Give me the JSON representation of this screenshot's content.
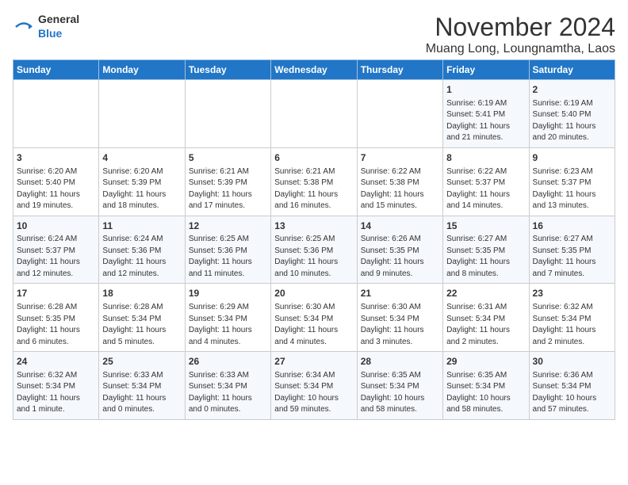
{
  "logo": {
    "text_general": "General",
    "text_blue": "Blue"
  },
  "title": "November 2024",
  "subtitle": "Muang Long, Loungnamtha, Laos",
  "days_of_week": [
    "Sunday",
    "Monday",
    "Tuesday",
    "Wednesday",
    "Thursday",
    "Friday",
    "Saturday"
  ],
  "weeks": [
    [
      {
        "day": "",
        "info": ""
      },
      {
        "day": "",
        "info": ""
      },
      {
        "day": "",
        "info": ""
      },
      {
        "day": "",
        "info": ""
      },
      {
        "day": "",
        "info": ""
      },
      {
        "day": "1",
        "info": "Sunrise: 6:19 AM\nSunset: 5:41 PM\nDaylight: 11 hours\nand 21 minutes."
      },
      {
        "day": "2",
        "info": "Sunrise: 6:19 AM\nSunset: 5:40 PM\nDaylight: 11 hours\nand 20 minutes."
      }
    ],
    [
      {
        "day": "3",
        "info": "Sunrise: 6:20 AM\nSunset: 5:40 PM\nDaylight: 11 hours\nand 19 minutes."
      },
      {
        "day": "4",
        "info": "Sunrise: 6:20 AM\nSunset: 5:39 PM\nDaylight: 11 hours\nand 18 minutes."
      },
      {
        "day": "5",
        "info": "Sunrise: 6:21 AM\nSunset: 5:39 PM\nDaylight: 11 hours\nand 17 minutes."
      },
      {
        "day": "6",
        "info": "Sunrise: 6:21 AM\nSunset: 5:38 PM\nDaylight: 11 hours\nand 16 minutes."
      },
      {
        "day": "7",
        "info": "Sunrise: 6:22 AM\nSunset: 5:38 PM\nDaylight: 11 hours\nand 15 minutes."
      },
      {
        "day": "8",
        "info": "Sunrise: 6:22 AM\nSunset: 5:37 PM\nDaylight: 11 hours\nand 14 minutes."
      },
      {
        "day": "9",
        "info": "Sunrise: 6:23 AM\nSunset: 5:37 PM\nDaylight: 11 hours\nand 13 minutes."
      }
    ],
    [
      {
        "day": "10",
        "info": "Sunrise: 6:24 AM\nSunset: 5:37 PM\nDaylight: 11 hours\nand 12 minutes."
      },
      {
        "day": "11",
        "info": "Sunrise: 6:24 AM\nSunset: 5:36 PM\nDaylight: 11 hours\nand 12 minutes."
      },
      {
        "day": "12",
        "info": "Sunrise: 6:25 AM\nSunset: 5:36 PM\nDaylight: 11 hours\nand 11 minutes."
      },
      {
        "day": "13",
        "info": "Sunrise: 6:25 AM\nSunset: 5:36 PM\nDaylight: 11 hours\nand 10 minutes."
      },
      {
        "day": "14",
        "info": "Sunrise: 6:26 AM\nSunset: 5:35 PM\nDaylight: 11 hours\nand 9 minutes."
      },
      {
        "day": "15",
        "info": "Sunrise: 6:27 AM\nSunset: 5:35 PM\nDaylight: 11 hours\nand 8 minutes."
      },
      {
        "day": "16",
        "info": "Sunrise: 6:27 AM\nSunset: 5:35 PM\nDaylight: 11 hours\nand 7 minutes."
      }
    ],
    [
      {
        "day": "17",
        "info": "Sunrise: 6:28 AM\nSunset: 5:35 PM\nDaylight: 11 hours\nand 6 minutes."
      },
      {
        "day": "18",
        "info": "Sunrise: 6:28 AM\nSunset: 5:34 PM\nDaylight: 11 hours\nand 5 minutes."
      },
      {
        "day": "19",
        "info": "Sunrise: 6:29 AM\nSunset: 5:34 PM\nDaylight: 11 hours\nand 4 minutes."
      },
      {
        "day": "20",
        "info": "Sunrise: 6:30 AM\nSunset: 5:34 PM\nDaylight: 11 hours\nand 4 minutes."
      },
      {
        "day": "21",
        "info": "Sunrise: 6:30 AM\nSunset: 5:34 PM\nDaylight: 11 hours\nand 3 minutes."
      },
      {
        "day": "22",
        "info": "Sunrise: 6:31 AM\nSunset: 5:34 PM\nDaylight: 11 hours\nand 2 minutes."
      },
      {
        "day": "23",
        "info": "Sunrise: 6:32 AM\nSunset: 5:34 PM\nDaylight: 11 hours\nand 2 minutes."
      }
    ],
    [
      {
        "day": "24",
        "info": "Sunrise: 6:32 AM\nSunset: 5:34 PM\nDaylight: 11 hours\nand 1 minute."
      },
      {
        "day": "25",
        "info": "Sunrise: 6:33 AM\nSunset: 5:34 PM\nDaylight: 11 hours\nand 0 minutes."
      },
      {
        "day": "26",
        "info": "Sunrise: 6:33 AM\nSunset: 5:34 PM\nDaylight: 11 hours\nand 0 minutes."
      },
      {
        "day": "27",
        "info": "Sunrise: 6:34 AM\nSunset: 5:34 PM\nDaylight: 10 hours\nand 59 minutes."
      },
      {
        "day": "28",
        "info": "Sunrise: 6:35 AM\nSunset: 5:34 PM\nDaylight: 10 hours\nand 58 minutes."
      },
      {
        "day": "29",
        "info": "Sunrise: 6:35 AM\nSunset: 5:34 PM\nDaylight: 10 hours\nand 58 minutes."
      },
      {
        "day": "30",
        "info": "Sunrise: 6:36 AM\nSunset: 5:34 PM\nDaylight: 10 hours\nand 57 minutes."
      }
    ]
  ]
}
